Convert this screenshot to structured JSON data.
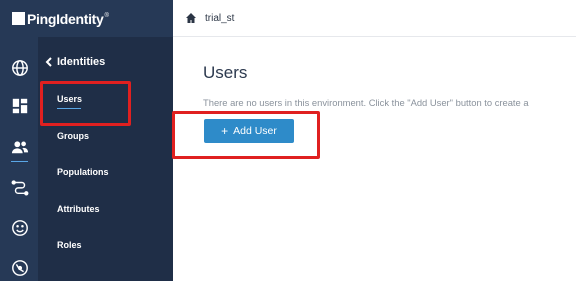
{
  "brand": {
    "name": "PingIdentity",
    "tm": "®"
  },
  "rail": {
    "icons": [
      "globe-icon",
      "dashboard-icon",
      "users-icon",
      "connections-icon",
      "experiences-icon",
      "settings-icon"
    ]
  },
  "subnav": {
    "back_label": "Identities",
    "items": [
      {
        "label": "Users",
        "active": true
      },
      {
        "label": "Groups"
      },
      {
        "label": "Populations"
      },
      {
        "label": "Attributes"
      },
      {
        "label": "Roles"
      }
    ]
  },
  "header": {
    "environment": "trial_st"
  },
  "main": {
    "title": "Users",
    "empty_message": "There are no users in this environment. Click the \"Add User\" button to create a",
    "add_button": {
      "icon": "+",
      "label": "Add User"
    }
  },
  "colors": {
    "sidebar_dark": "#1f2e47",
    "rail": "#263956",
    "accent": "#2e8bc9",
    "highlight": "#e02020"
  }
}
